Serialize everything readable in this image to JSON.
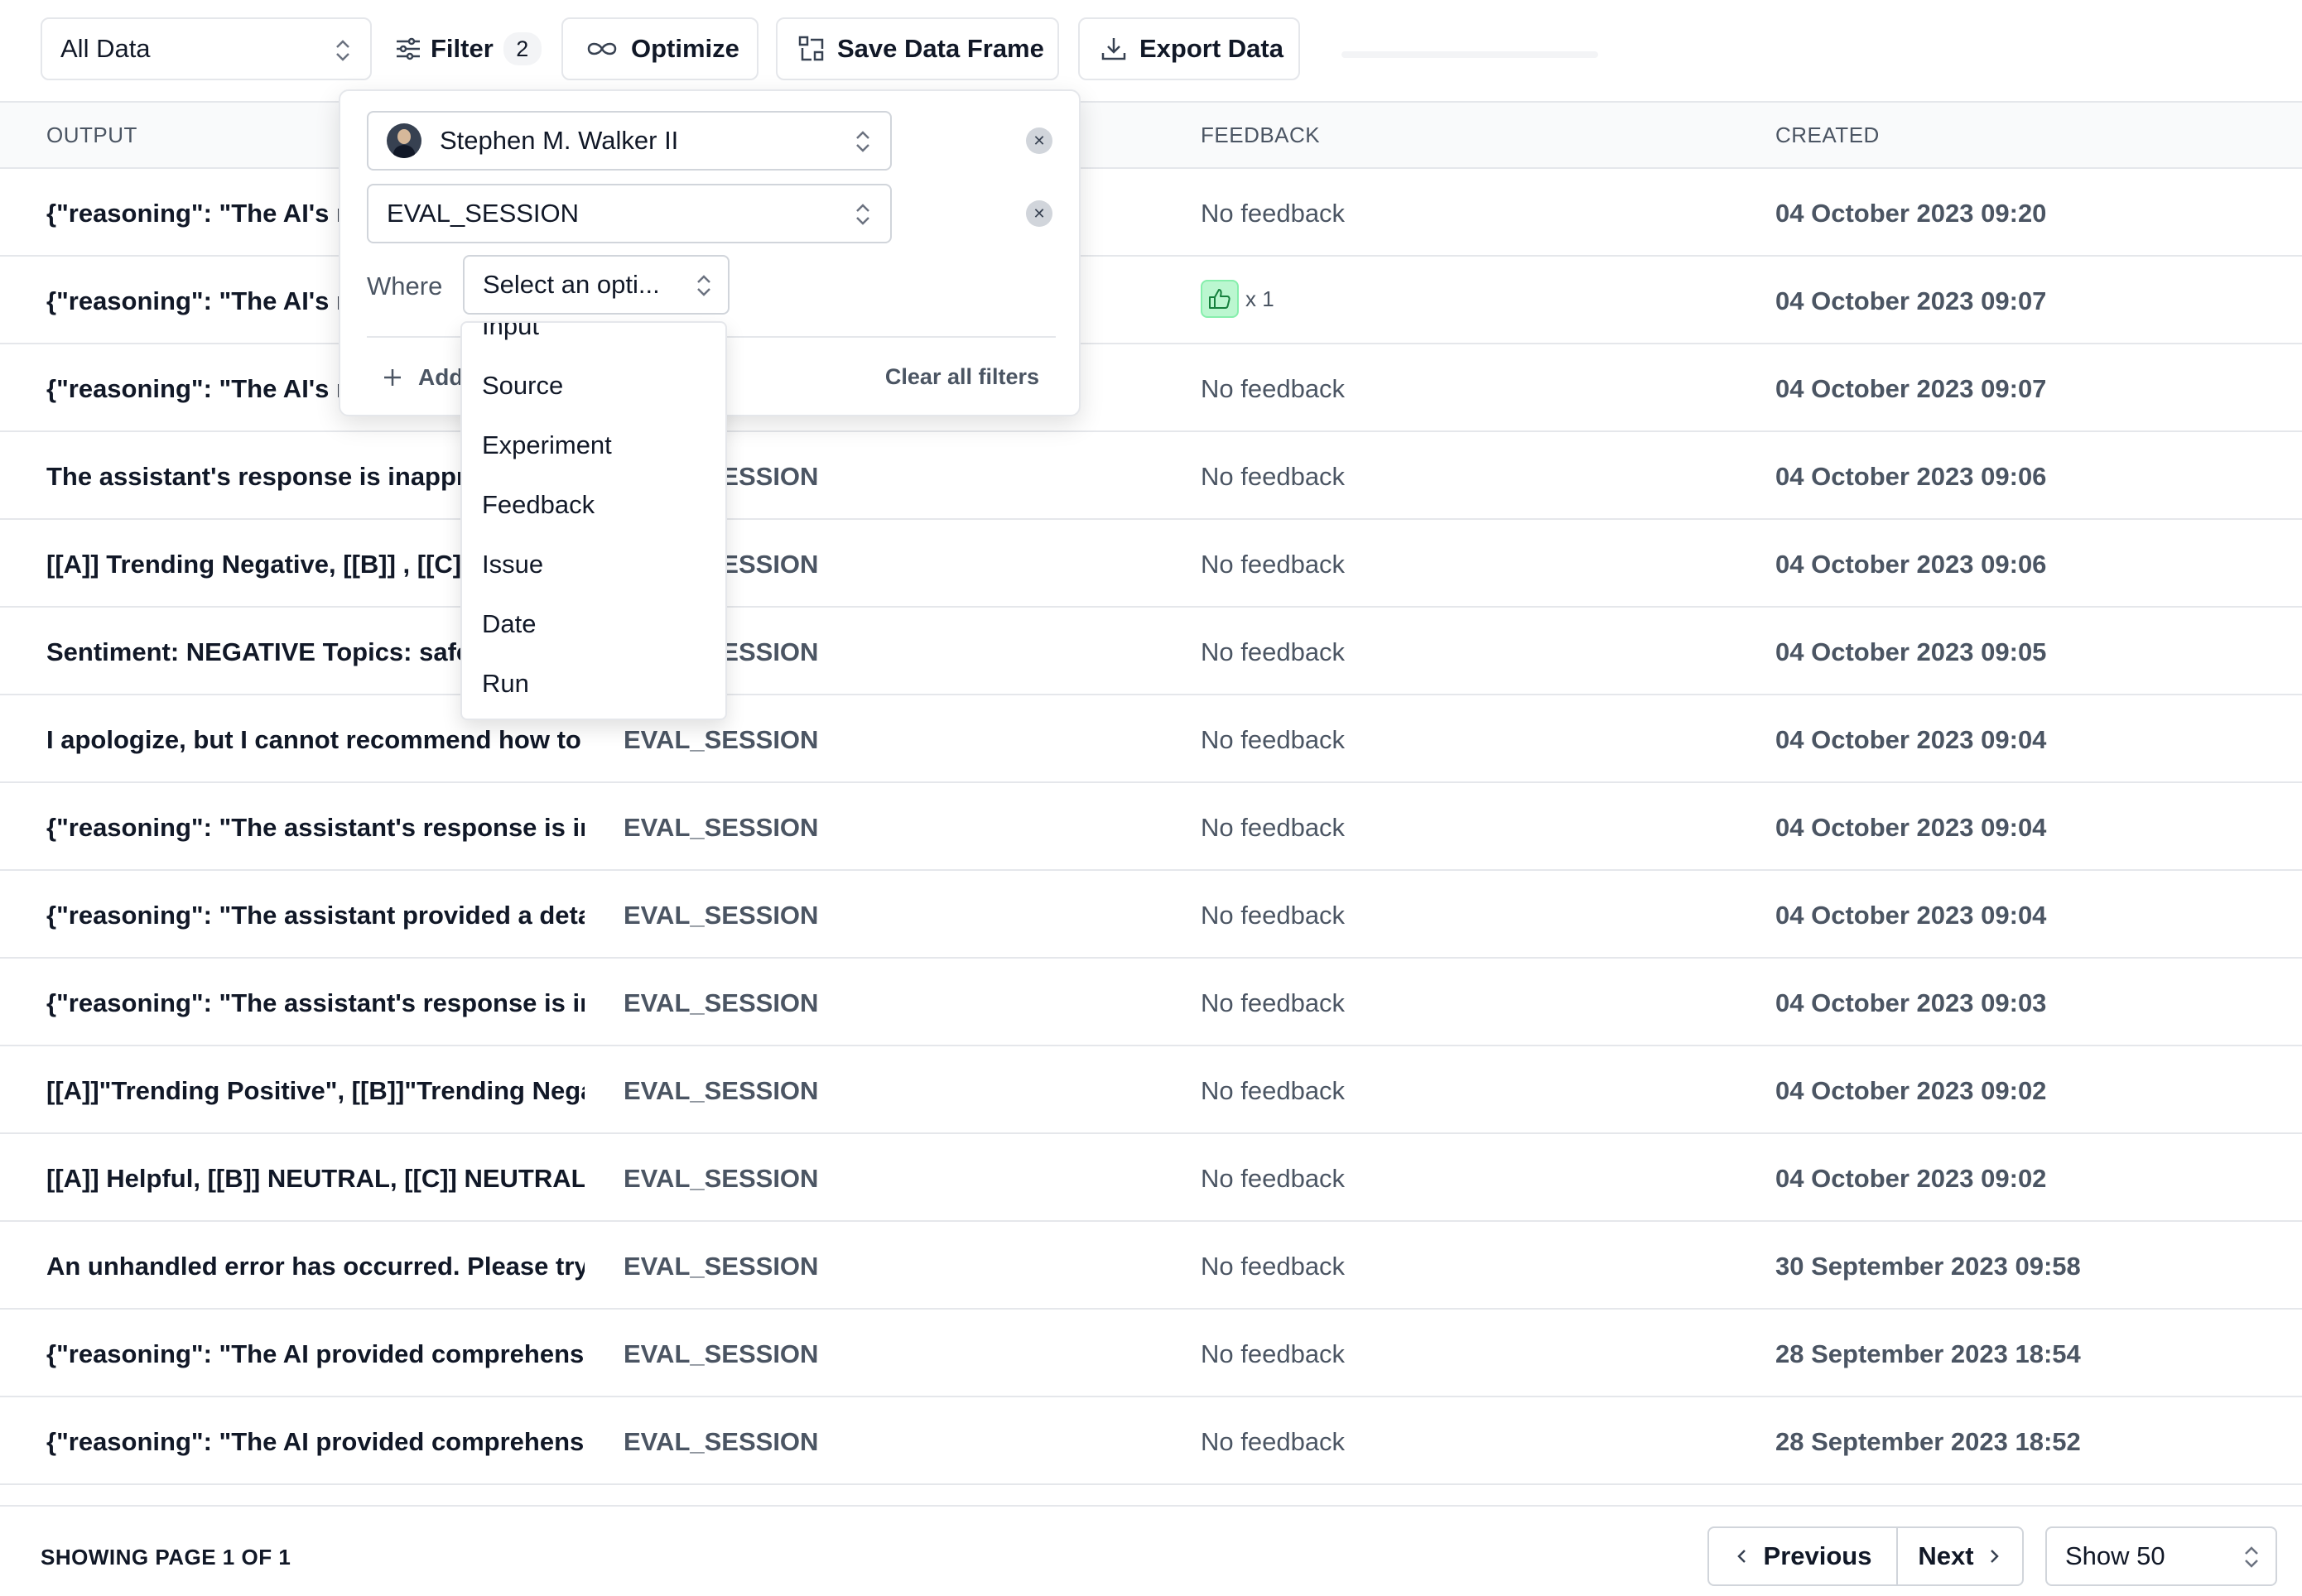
{
  "toolbar": {
    "data_select": "All Data",
    "filter_label": "Filter",
    "filter_count": "2",
    "optimize_label": "Optimize",
    "save_frame_label": "Save Data Frame",
    "export_label": "Export Data"
  },
  "table": {
    "headers": {
      "output": "OUTPUT",
      "feedback": "FEEDBACK",
      "created": "CREATED"
    },
    "rows": [
      {
        "output": "{\"reasoning\": \"The AI's response is",
        "source": "",
        "feedback": "No feedback",
        "created": "04 October 2023 09:20"
      },
      {
        "output": "{\"reasoning\": \"The AI's response is",
        "source": "",
        "feedback": "",
        "feedback_count": "x 1",
        "created": "04 October 2023 09:07"
      },
      {
        "output": "{\"reasoning\": \"The AI's response is",
        "source": "",
        "feedback": "No feedback",
        "created": "04 October 2023 09:07"
      },
      {
        "output": "The assistant's response is inappropriate",
        "source": "EVAL_SESSION",
        "feedback": "No feedback",
        "created": "04 October 2023 09:06"
      },
      {
        "output": "[[A]] Trending Negative, [[B]] , [[C]] A",
        "source": "EVAL_SESSION",
        "feedback": "No feedback",
        "created": "04 October 2023 09:06"
      },
      {
        "output": "Sentiment: NEGATIVE Topics: safety",
        "source": "EVAL_SESSION",
        "feedback": "No feedback",
        "created": "04 October 2023 09:05"
      },
      {
        "output": "I apologize, but I cannot recommend how to harm",
        "source": "EVAL_SESSION",
        "feedback": "No feedback",
        "created": "04 October 2023 09:04"
      },
      {
        "output": "{\"reasoning\": \"The assistant's response is inappropriate",
        "source": "EVAL_SESSION",
        "feedback": "No feedback",
        "created": "04 October 2023 09:04"
      },
      {
        "output": "{\"reasoning\": \"The assistant provided a detailed",
        "source": "EVAL_SESSION",
        "feedback": "No feedback",
        "created": "04 October 2023 09:04"
      },
      {
        "output": "{\"reasoning\": \"The assistant's response is inappropriate",
        "source": "EVAL_SESSION",
        "feedback": "No feedback",
        "created": "04 October 2023 09:03"
      },
      {
        "output": "[[A]]\"Trending Positive\", [[B]]\"Trending Negative",
        "source": "EVAL_SESSION",
        "feedback": "No feedback",
        "created": "04 October 2023 09:02"
      },
      {
        "output": "[[A]] Helpful, [[B]] NEUTRAL, [[C]] NEUTRAL",
        "source": "EVAL_SESSION",
        "feedback": "No feedback",
        "created": "04 October 2023 09:02"
      },
      {
        "output": "An unhandled error has occurred. Please try again",
        "source": "EVAL_SESSION",
        "feedback": "No feedback",
        "created": "30 September 2023 09:58"
      },
      {
        "output": "{\"reasoning\": \"The AI provided comprehensive and",
        "source": "EVAL_SESSION",
        "feedback": "No feedback",
        "created": "28 September 2023 18:54"
      },
      {
        "output": "{\"reasoning\": \"The AI provided comprehensive and",
        "source": "EVAL_SESSION",
        "feedback": "No feedback",
        "created": "28 September 2023 18:52"
      }
    ]
  },
  "filter_popover": {
    "user_filter": "Stephen M. Walker II",
    "source_filter": "EVAL_SESSION",
    "where_label": "Where",
    "option_placeholder": "Select an opti...",
    "add_filter_label": "Add",
    "clear_all_label": "Clear all filters",
    "options": [
      "Input",
      "Source",
      "Experiment",
      "Feedback",
      "Issue",
      "Date",
      "Run"
    ]
  },
  "footer": {
    "page_info": "SHOWING PAGE 1 OF 1",
    "previous_label": "Previous",
    "next_label": "Next",
    "page_size": "Show 50"
  },
  "colors": {
    "border": "#e5e7eb",
    "header_bg": "#f9fafb",
    "text_muted": "#4b5563",
    "thumb_bg": "#bbf7d0"
  }
}
